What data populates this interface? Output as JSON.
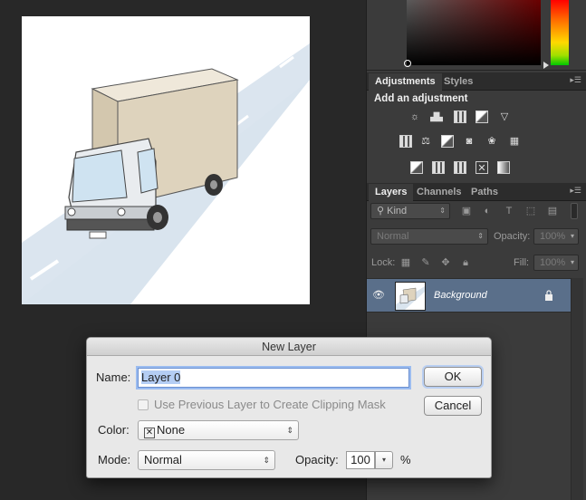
{
  "colors": {
    "selection": "#5a6f8a",
    "accent": "#6a8fd0",
    "panel": "#3b3b3b",
    "canvas_bg": "#282828"
  },
  "adjustments_panel": {
    "tabs": [
      "Adjustments",
      "Styles"
    ],
    "title": "Add an adjustment",
    "icons": [
      "brightness-contrast-icon",
      "levels-icon",
      "curves-icon",
      "exposure-icon",
      "vibrance-icon",
      "hue-saturation-icon",
      "color-balance-icon",
      "black-white-icon",
      "photo-filter-icon",
      "channel-mixer-icon",
      "color-lookup-icon",
      "invert-icon",
      "posterize-icon",
      "threshold-icon",
      "gradient-map-icon",
      "selective-color-icon"
    ]
  },
  "layers_panel": {
    "tabs": [
      "Layers",
      "Channels",
      "Paths"
    ],
    "filter_kind": "Kind",
    "blend_mode": "Normal",
    "opacity_label": "Opacity:",
    "opacity_value": "100%",
    "lock_label": "Lock:",
    "fill_label": "Fill:",
    "fill_value": "100%",
    "layer_name": "Background"
  },
  "dialog": {
    "title": "New Layer",
    "name_label": "Name:",
    "name_value": "Layer 0",
    "clipping_label": "Use Previous Layer to Create Clipping Mask",
    "color_label": "Color:",
    "color_value": "None",
    "mode_label": "Mode:",
    "mode_value": "Normal",
    "opacity_label": "Opacity:",
    "opacity_value": "100",
    "percent": "%",
    "ok_label": "OK",
    "cancel_label": "Cancel"
  }
}
